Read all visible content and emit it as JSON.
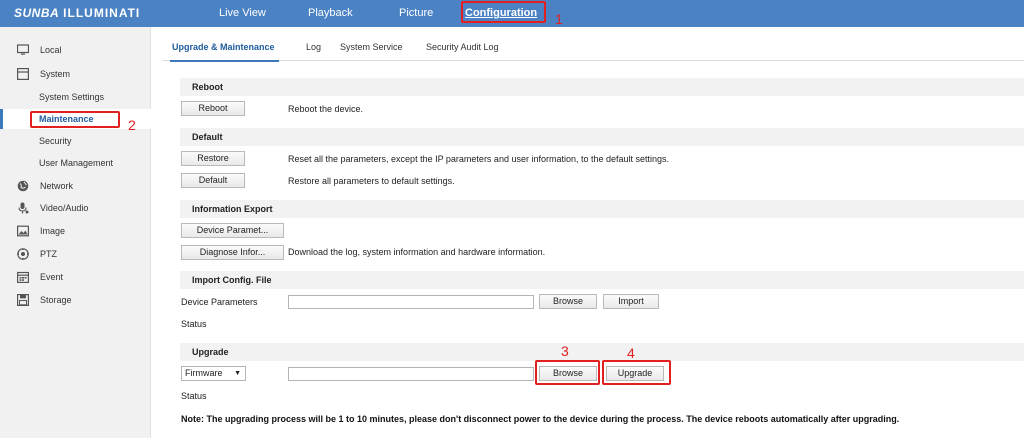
{
  "app": {
    "brand": "SUNBA",
    "product": "ILLUMINATI"
  },
  "topnav": {
    "items": [
      {
        "label": "Live View"
      },
      {
        "label": "Playback"
      },
      {
        "label": "Picture"
      },
      {
        "label": "Configuration"
      }
    ],
    "active": "Configuration"
  },
  "sidebar": {
    "items": [
      {
        "label": "Local",
        "icon": "monitor-icon"
      },
      {
        "label": "System",
        "icon": "system-icon"
      },
      {
        "label": "System Settings"
      },
      {
        "label": "Maintenance"
      },
      {
        "label": "Security"
      },
      {
        "label": "User Management"
      },
      {
        "label": "Network",
        "icon": "globe-icon"
      },
      {
        "label": "Video/Audio",
        "icon": "microphone-icon"
      },
      {
        "label": "Image",
        "icon": "image-icon"
      },
      {
        "label": "PTZ",
        "icon": "ptz-icon"
      },
      {
        "label": "Event",
        "icon": "calendar-icon"
      },
      {
        "label": "Storage",
        "icon": "disk-icon"
      }
    ],
    "selected": "Maintenance"
  },
  "tabs": [
    {
      "label": "Upgrade & Maintenance"
    },
    {
      "label": "Log"
    },
    {
      "label": "System Service"
    },
    {
      "label": "Security Audit Log"
    }
  ],
  "reboot": {
    "title": "Reboot",
    "button": "Reboot",
    "desc": "Reboot the device."
  },
  "default": {
    "title": "Default",
    "restore_button": "Restore",
    "restore_desc": "Reset all the parameters, except the IP parameters and user information, to the default settings.",
    "default_button": "Default",
    "default_desc": "Restore all parameters to default settings."
  },
  "export": {
    "title": "Information Export",
    "device_param_button": "Device Paramet...",
    "diagnose_button": "Diagnose Infor...",
    "diagnose_desc": "Download the log, system information and hardware information."
  },
  "import_config": {
    "title": "Import Config. File",
    "label": "Device Parameters",
    "value": "",
    "browse": "Browse",
    "import": "Import",
    "status_label": "Status"
  },
  "upgrade": {
    "title": "Upgrade",
    "select_value": "Firmware",
    "select_arrow": "▼",
    "value": "",
    "browse": "Browse",
    "upgrade": "Upgrade",
    "status_label": "Status"
  },
  "note": "Note: The upgrading process will be 1 to 10 minutes, please don't disconnect power to the device during the process. The device reboots automatically after upgrading.",
  "annotations": {
    "n1": "1",
    "n2": "2",
    "n3": "3",
    "n4": "4",
    "color": "#e22020"
  },
  "colors": {
    "topbar": "#4a82c3",
    "accent": "#3d78bd",
    "sidebar_bg": "#f1f1f1",
    "section_bg": "#f2f2f2"
  }
}
